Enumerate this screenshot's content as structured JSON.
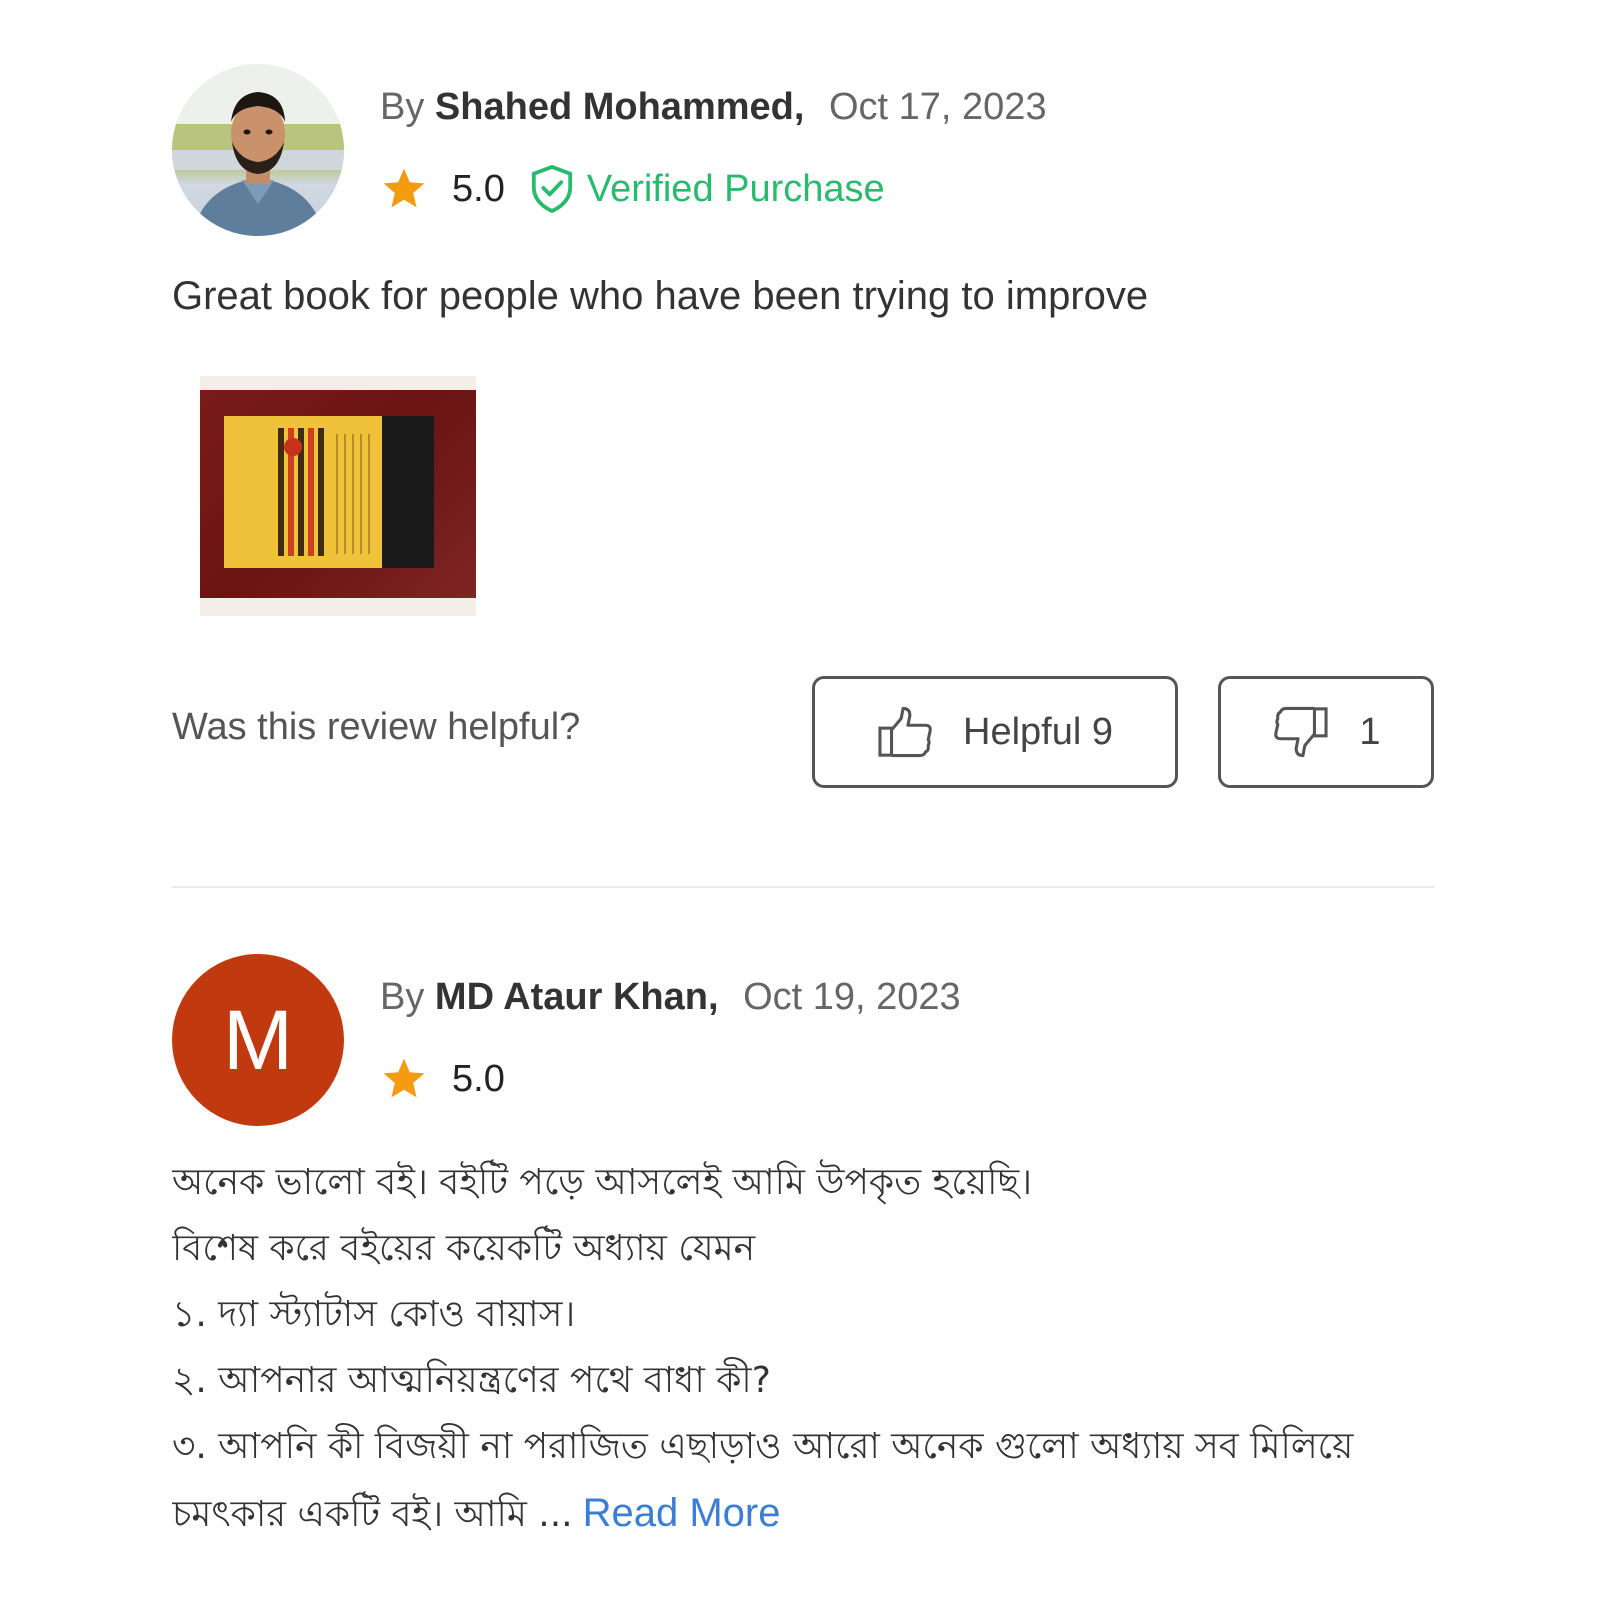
{
  "reviews": [
    {
      "by_label": "By",
      "author": "Shahed Mohammed,",
      "date": "Oct 17, 2023",
      "rating": "5.0",
      "verified_label": "Verified Purchase",
      "text": "Great book for people who have been trying to improve",
      "helpful_question": "Was this review helpful?",
      "helpful_label": "Helpful 9",
      "unhelpful_count": "1",
      "avatar": "profile-photo",
      "photo": "book-cover-photo"
    },
    {
      "by_label": "By",
      "author": "MD Ataur Khan,",
      "date": "Oct 19, 2023",
      "rating": "5.0",
      "avatar_letter": "M",
      "text_lines": [
        "অনেক ভালো বই। বইটি পড়ে আসলেই আমি উপকৃত হয়েছি।",
        "বিশেষ করে বইয়ের কয়েকটি  অধ্যায় যেমন",
        "১. দ্যা স্ট্যাটাস কোও বায়াস।",
        "২. আপনার আত্মনিয়ন্ত্রণের পথে বাধা কী?",
        "৩. আপনি কী বিজয়ী না পরাজিত এছাড়াও আরো অনেক গুলো অধ্যায় সব মিলিয়ে",
        "চমৎকার একটি বই। আমি ..."
      ],
      "read_more": "Read More"
    }
  ],
  "colors": {
    "star": "#f39c12",
    "verified": "#2aba6e",
    "link": "#3a7fd5",
    "avatar_bg": "#c0390f"
  }
}
